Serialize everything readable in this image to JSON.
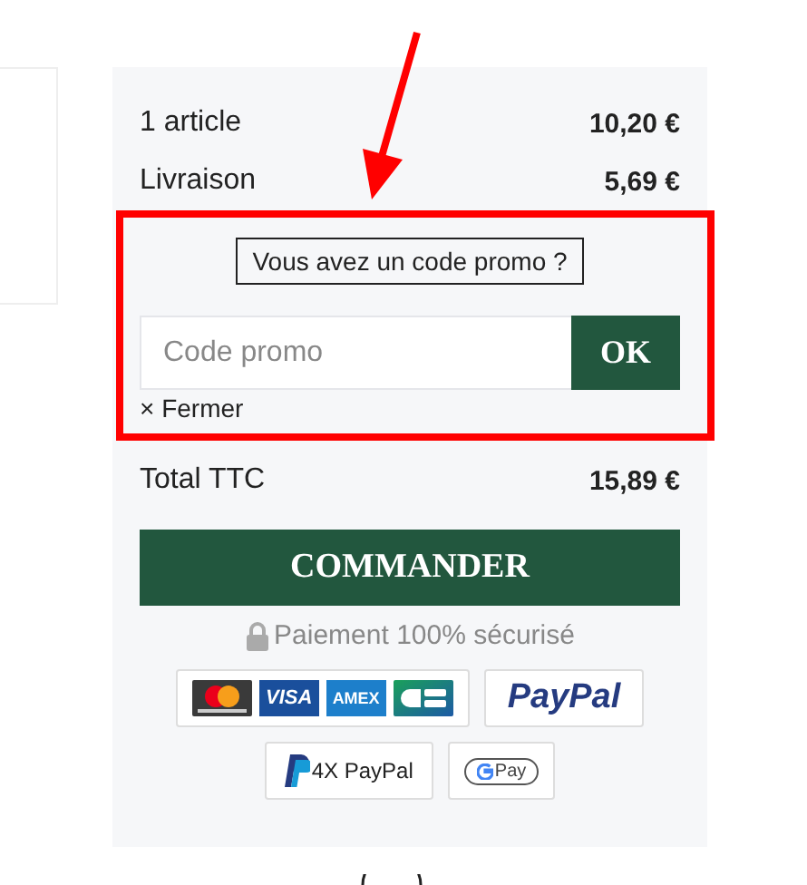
{
  "summary": {
    "rows": [
      {
        "label": "1 article",
        "value": "10,20 €"
      },
      {
        "label": "Livraison",
        "value": "5,69 €"
      }
    ]
  },
  "promo": {
    "title": "Vous avez un code promo ?",
    "placeholder": "Code promo",
    "button": "OK",
    "close_icon": "×",
    "close": "Fermer"
  },
  "total": {
    "label": "Total TTC",
    "value": "15,89 €"
  },
  "order_button": "COMMANDER",
  "secure_note": "Paiement 100% sécurisé",
  "payment_rows": [
    [
      {
        "logos": [
          {
            "kind": "mastercard"
          },
          {
            "kind": "visa",
            "text": "VISA"
          },
          {
            "kind": "amex",
            "text": "AMEX"
          },
          {
            "kind": "cb"
          }
        ]
      },
      {
        "logos": [
          {
            "kind": "paypal",
            "text": "PayPal"
          }
        ]
      }
    ],
    [
      {
        "logos": [
          {
            "kind": "paypal_4x",
            "text": "4X PayPal"
          }
        ]
      },
      {
        "logos": [
          {
            "kind": "gpay",
            "text": "Pay"
          }
        ]
      }
    ]
  ]
}
